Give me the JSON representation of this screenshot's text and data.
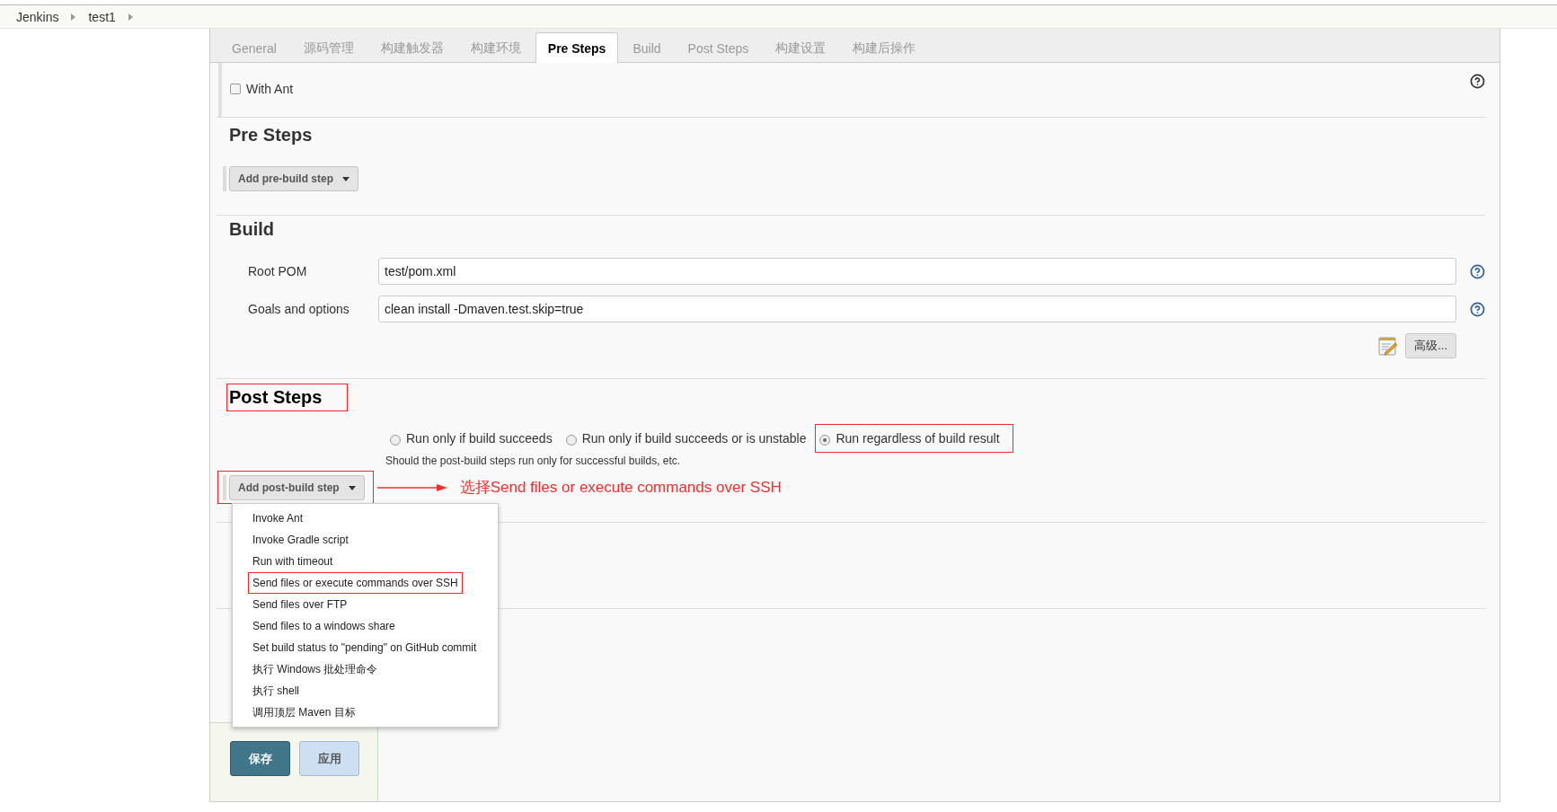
{
  "breadcrumb": [
    {
      "label": "Jenkins"
    },
    {
      "label": "test1"
    }
  ],
  "tabs": [
    {
      "label": "General",
      "selected": false
    },
    {
      "label": "源码管理",
      "selected": false
    },
    {
      "label": "构建触发器",
      "selected": false
    },
    {
      "label": "构建环境",
      "selected": false
    },
    {
      "label": "Pre Steps",
      "selected": true
    },
    {
      "label": "Build",
      "selected": false
    },
    {
      "label": "Post Steps",
      "selected": false
    },
    {
      "label": "构建设置",
      "selected": false
    },
    {
      "label": "构建后操作",
      "selected": false
    }
  ],
  "build_env_rows": [
    {
      "label": "With Ant",
      "checked": false
    }
  ],
  "pre_steps": {
    "heading": {
      "text": "Pre Steps",
      "highlighted": false
    },
    "add_button": {
      "label": "Add pre-build step",
      "highlighted": false
    }
  },
  "build": {
    "heading": {
      "text": "Build",
      "highlighted": false
    },
    "fields": [
      {
        "label": "Root POM",
        "value": "test/pom.xml"
      },
      {
        "label": "Goals and options",
        "value": "clean install -Dmaven.test.skip=true"
      }
    ],
    "advanced_button": "高级..."
  },
  "post_steps": {
    "heading": {
      "text": "Post Steps",
      "highlighted": true
    },
    "options": [
      {
        "label": "Run only if build succeeds",
        "selected": false,
        "highlighted": false
      },
      {
        "label": "Run only if build succeeds or is unstable",
        "selected": false,
        "highlighted": false
      },
      {
        "label": "Run regardless of build result",
        "selected": true,
        "highlighted": true
      }
    ],
    "hint": "Should the post-build steps run only for successful builds, etc.",
    "add_button": {
      "label": "Add post-build step",
      "highlighted": true
    },
    "menu": [
      {
        "label": "Invoke Ant",
        "highlighted": false
      },
      {
        "label": "Invoke Gradle script",
        "highlighted": false
      },
      {
        "label": "Run with timeout",
        "highlighted": false
      },
      {
        "label": "Send files or execute commands over SSH",
        "highlighted": true
      },
      {
        "label": "Send files over FTP",
        "highlighted": false
      },
      {
        "label": "Send files to a windows share",
        "highlighted": false
      },
      {
        "label": "Set build status to \"pending\" on GitHub commit",
        "highlighted": false
      },
      {
        "label": "执行 Windows 批处理命令",
        "highlighted": false
      },
      {
        "label": "执行 shell",
        "highlighted": false
      },
      {
        "label": "调用顶层 Maven 目标",
        "highlighted": false
      }
    ]
  },
  "annotation": "选择Send files or execute commands over SSH",
  "footer_buttons": [
    {
      "label": "保存",
      "kind": "primary"
    },
    {
      "label": "应用",
      "kind": "secondary"
    }
  ]
}
